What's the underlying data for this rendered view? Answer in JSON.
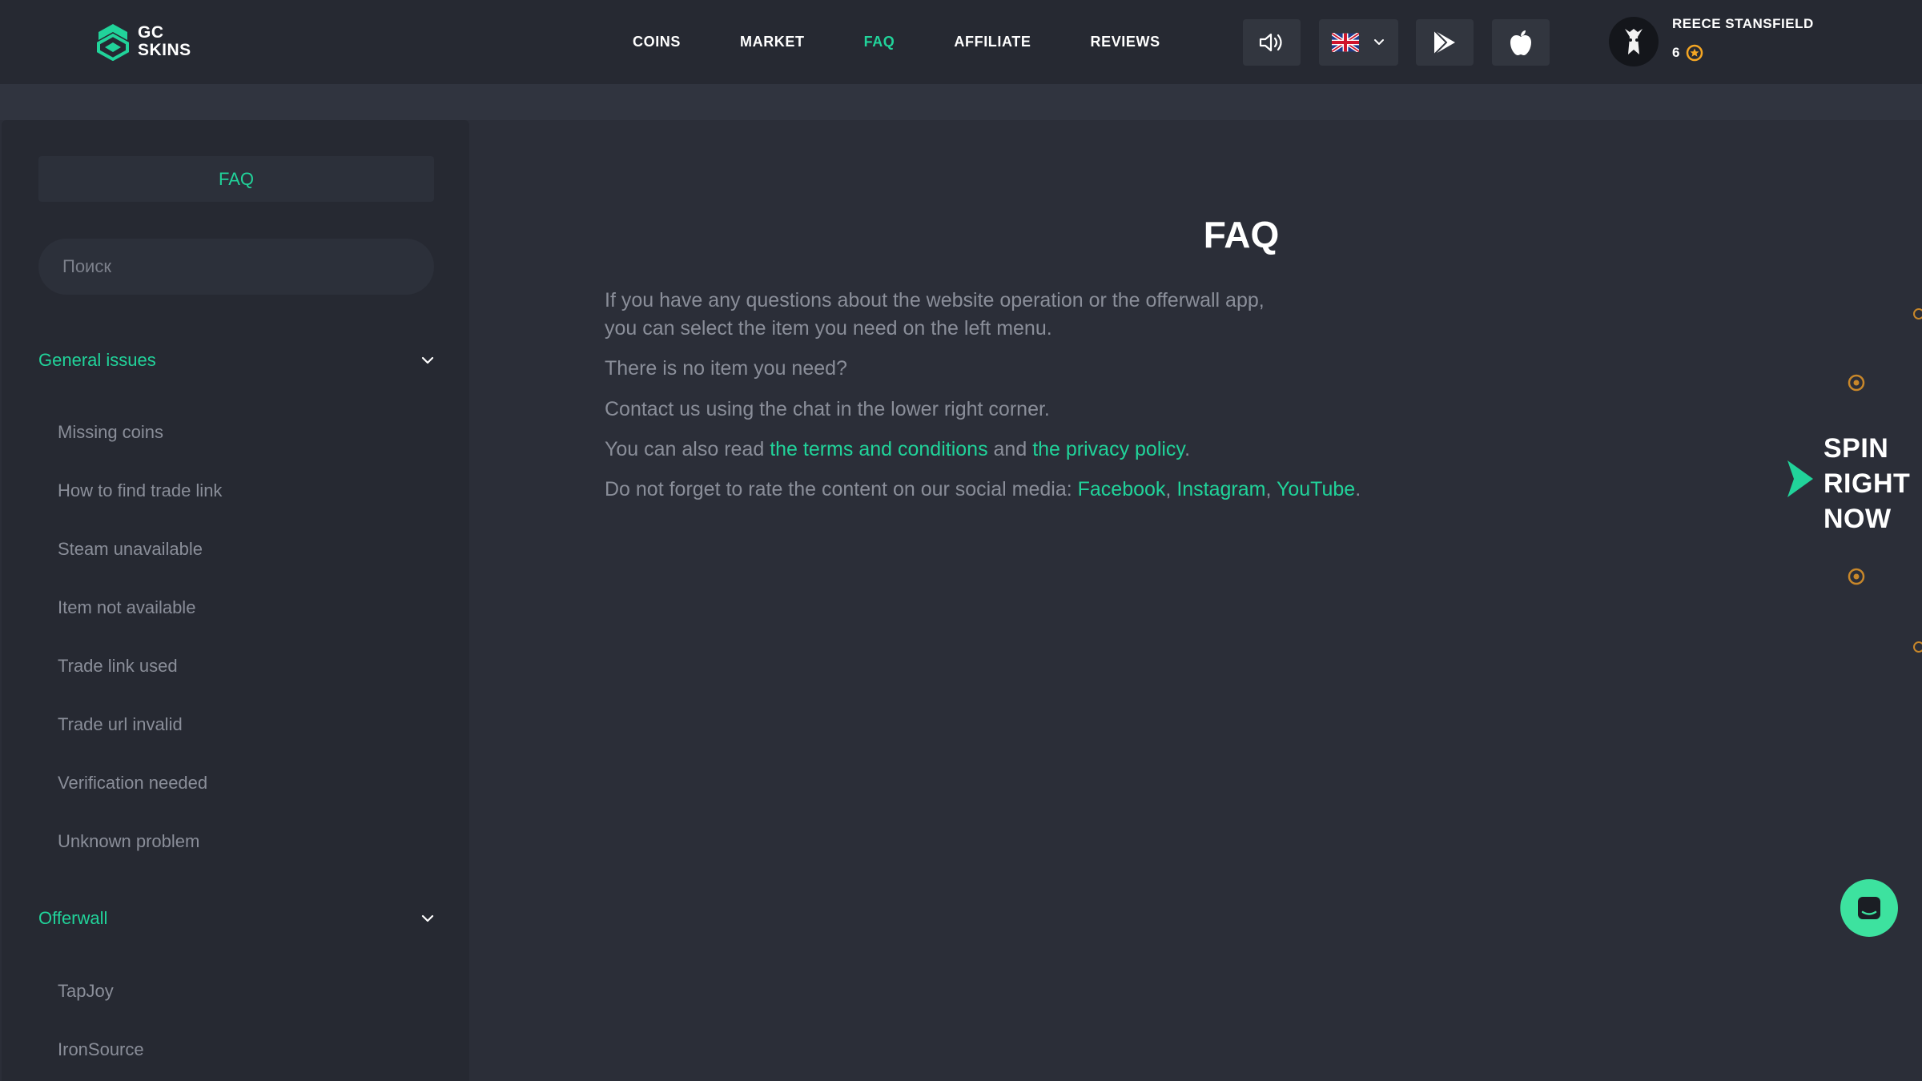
{
  "brand": {
    "line1": "GC",
    "line2": "SKINS",
    "accent": "#21d39a"
  },
  "nav": [
    {
      "label": "COINS",
      "active": false
    },
    {
      "label": "MARKET",
      "active": false
    },
    {
      "label": "FAQ",
      "active": true
    },
    {
      "label": "AFFILIATE",
      "active": false
    },
    {
      "label": "REVIEWS",
      "active": false
    }
  ],
  "header_icons": {
    "sound": "speaker-icon",
    "language": "uk-flag-icon",
    "google_play": "play-store-icon",
    "app_store": "apple-icon"
  },
  "user": {
    "name": "REECE STANSFIELD",
    "balance": "6",
    "coin_icon": "coin-icon"
  },
  "sidebar": {
    "title": "FAQ",
    "search_placeholder": "Поиск",
    "sections": [
      {
        "label": "General issues",
        "expanded": true,
        "items": [
          "Missing coins",
          "How to find trade link",
          "Steam unavailable",
          "Item not available",
          "Trade link used",
          "Trade url invalid",
          "Verification needed",
          "Unknown problem"
        ]
      },
      {
        "label": "Offerwall",
        "expanded": true,
        "items": [
          "TapJoy",
          "IronSource"
        ]
      }
    ]
  },
  "main": {
    "title": "FAQ",
    "intro_line1": "If you have any questions about the website operation or the offerwall app,",
    "intro_line2": "you can select the item you need on the left menu.",
    "no_item": "There is no item you need?",
    "contact": "Contact us using the chat in the lower right corner.",
    "read_prefix": "You can also read ",
    "terms_link": "the terms and conditions",
    "and_text": " and ",
    "privacy_link": "the privacy policy",
    "period": ".",
    "social_prefix": "Do not forget to rate the content on our social media: ",
    "facebook": "Facebook",
    "comma1": ", ",
    "instagram": "Instagram",
    "comma2": ", ",
    "youtube": "YouTube",
    "social_period": "."
  },
  "spin": {
    "line1": "SPIN",
    "line2": "RIGHT",
    "line3": "NOW"
  },
  "chat": {
    "icon": "chat-icon"
  }
}
